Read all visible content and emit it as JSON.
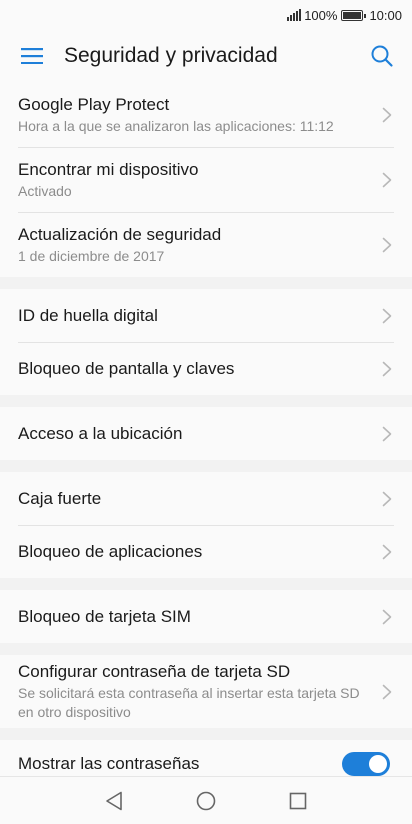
{
  "status": {
    "signal_icon": "signal-icon",
    "battery_percent": "100%",
    "battery_icon": "battery-icon",
    "time": "10:00"
  },
  "header": {
    "title": "Seguridad y privacidad",
    "menu_icon": "hamburger-menu-icon",
    "search_icon": "search-icon"
  },
  "accent": "#1e7fd9",
  "groups": [
    {
      "items": [
        {
          "label": "Google Play Protect",
          "sub": "Hora a la que se analizaron las aplicaciones: 11:12"
        },
        {
          "label": "Encontrar mi dispositivo",
          "sub": "Activado"
        },
        {
          "label": "Actualización de seguridad",
          "sub": "1 de diciembre de 2017"
        }
      ]
    },
    {
      "items": [
        {
          "label": "ID de huella digital"
        },
        {
          "label": "Bloqueo de pantalla y claves"
        }
      ]
    },
    {
      "items": [
        {
          "label": "Acceso a la ubicación"
        }
      ]
    },
    {
      "items": [
        {
          "label": "Caja fuerte"
        },
        {
          "label": "Bloqueo de aplicaciones"
        }
      ]
    },
    {
      "items": [
        {
          "label": "Bloqueo de tarjeta SIM"
        }
      ]
    },
    {
      "items": [
        {
          "label": "Configurar contraseña de tarjeta SD",
          "sub": "Se solicitará esta contraseña al insertar esta tarjeta SD en otro dispositivo"
        }
      ]
    },
    {
      "items": [
        {
          "label": "Mostrar las contraseñas",
          "toggle_on": true
        }
      ]
    }
  ],
  "navbar": {
    "back_icon": "back-triangle-icon",
    "home_icon": "home-circle-icon",
    "recents_icon": "recents-square-icon"
  }
}
